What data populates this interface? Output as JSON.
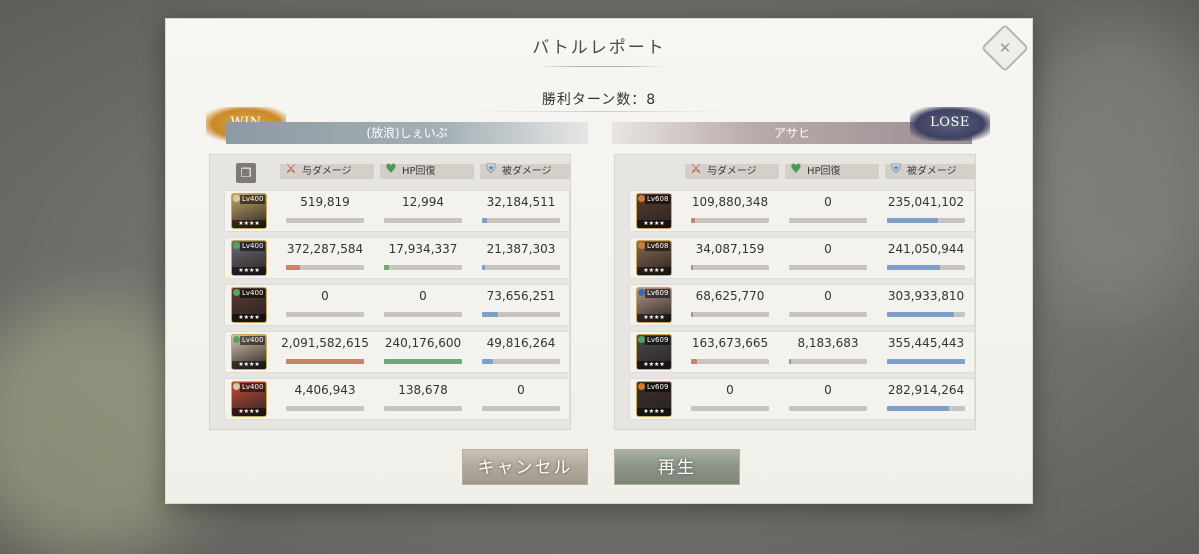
{
  "dialog": {
    "title": "バトルレポート",
    "turns_label": "勝利ターン数：8",
    "close_icon": "close-icon"
  },
  "left_team": {
    "result": "WIN",
    "name": "(放浪)しぇいぶ",
    "columns": [
      "与ダメージ",
      "HP回復",
      "被ダメージ"
    ],
    "rows": [
      {
        "level": "Lv400",
        "element_color": "#d9c9a0",
        "avatar_color": "#c7a86a",
        "dmg": "519,819",
        "hp": "12,994",
        "taken": "32,184,511",
        "dmg_frac": 0.0,
        "hp_frac": 0.0,
        "taken_frac": 0.06
      },
      {
        "level": "Lv400",
        "element_color": "#5aa060",
        "avatar_color": "#6e6a78",
        "dmg": "372,287,584",
        "hp": "17,934,337",
        "taken": "21,387,303",
        "dmg_frac": 0.18,
        "hp_frac": 0.07,
        "taken_frac": 0.04
      },
      {
        "level": "Lv400",
        "element_color": "#5aa060",
        "avatar_color": "#5a3a30",
        "dmg": "0",
        "hp": "0",
        "taken": "73,656,251",
        "dmg_frac": 0.0,
        "hp_frac": 0.0,
        "taken_frac": 0.2
      },
      {
        "level": "Lv400",
        "element_color": "#5aa060",
        "avatar_color": "#d8c7b0",
        "dmg": "2,091,582,615",
        "hp": "240,176,600",
        "taken": "49,816,264",
        "dmg_frac": 1.0,
        "hp_frac": 1.0,
        "taken_frac": 0.14
      },
      {
        "level": "Lv400",
        "element_color": "#d9c9a0",
        "avatar_color": "#c84a3a",
        "dmg": "4,406,943",
        "hp": "138,678",
        "taken": "0",
        "dmg_frac": 0.0,
        "hp_frac": 0.0,
        "taken_frac": 0.0
      }
    ]
  },
  "right_team": {
    "result": "LOSE",
    "name": "アサヒ",
    "columns": [
      "与ダメージ",
      "HP回復",
      "被ダメージ"
    ],
    "rows": [
      {
        "level": "Lv608",
        "element_color": "#d07a30",
        "avatar_color": "#5a3a2e",
        "dmg": "109,880,348",
        "hp": "0",
        "taken": "235,041,102",
        "dmg_frac": 0.05,
        "hp_frac": 0.0,
        "taken_frac": 0.66
      },
      {
        "level": "Lv608",
        "element_color": "#d07a30",
        "avatar_color": "#8a6a50",
        "dmg": "34,087,159",
        "hp": "0",
        "taken": "241,050,944",
        "dmg_frac": 0.02,
        "hp_frac": 0.0,
        "taken_frac": 0.68
      },
      {
        "level": "Lv609",
        "element_color": "#3a6ab0",
        "avatar_color": "#b59a8a",
        "dmg": "68,625,770",
        "hp": "0",
        "taken": "303,933,810",
        "dmg_frac": 0.03,
        "hp_frac": 0.0,
        "taken_frac": 0.86
      },
      {
        "level": "Lv609",
        "element_color": "#5aa060",
        "avatar_color": "#4a4a4a",
        "dmg": "163,673,665",
        "hp": "8,183,683",
        "taken": "355,445,443",
        "dmg_frac": 0.08,
        "hp_frac": 0.03,
        "taken_frac": 1.0
      },
      {
        "level": "Lv609",
        "element_color": "#d07a30",
        "avatar_color": "#3a2e28",
        "dmg": "0",
        "hp": "0",
        "taken": "282,914,264",
        "dmg_frac": 0.0,
        "hp_frac": 0.0,
        "taken_frac": 0.8
      }
    ]
  },
  "buttons": {
    "cancel": "キャンセル",
    "replay": "再生"
  },
  "icons": {
    "damage": "sword-icon",
    "heal": "heart-icon",
    "taken": "shield-icon",
    "copy": "copy-icon"
  }
}
